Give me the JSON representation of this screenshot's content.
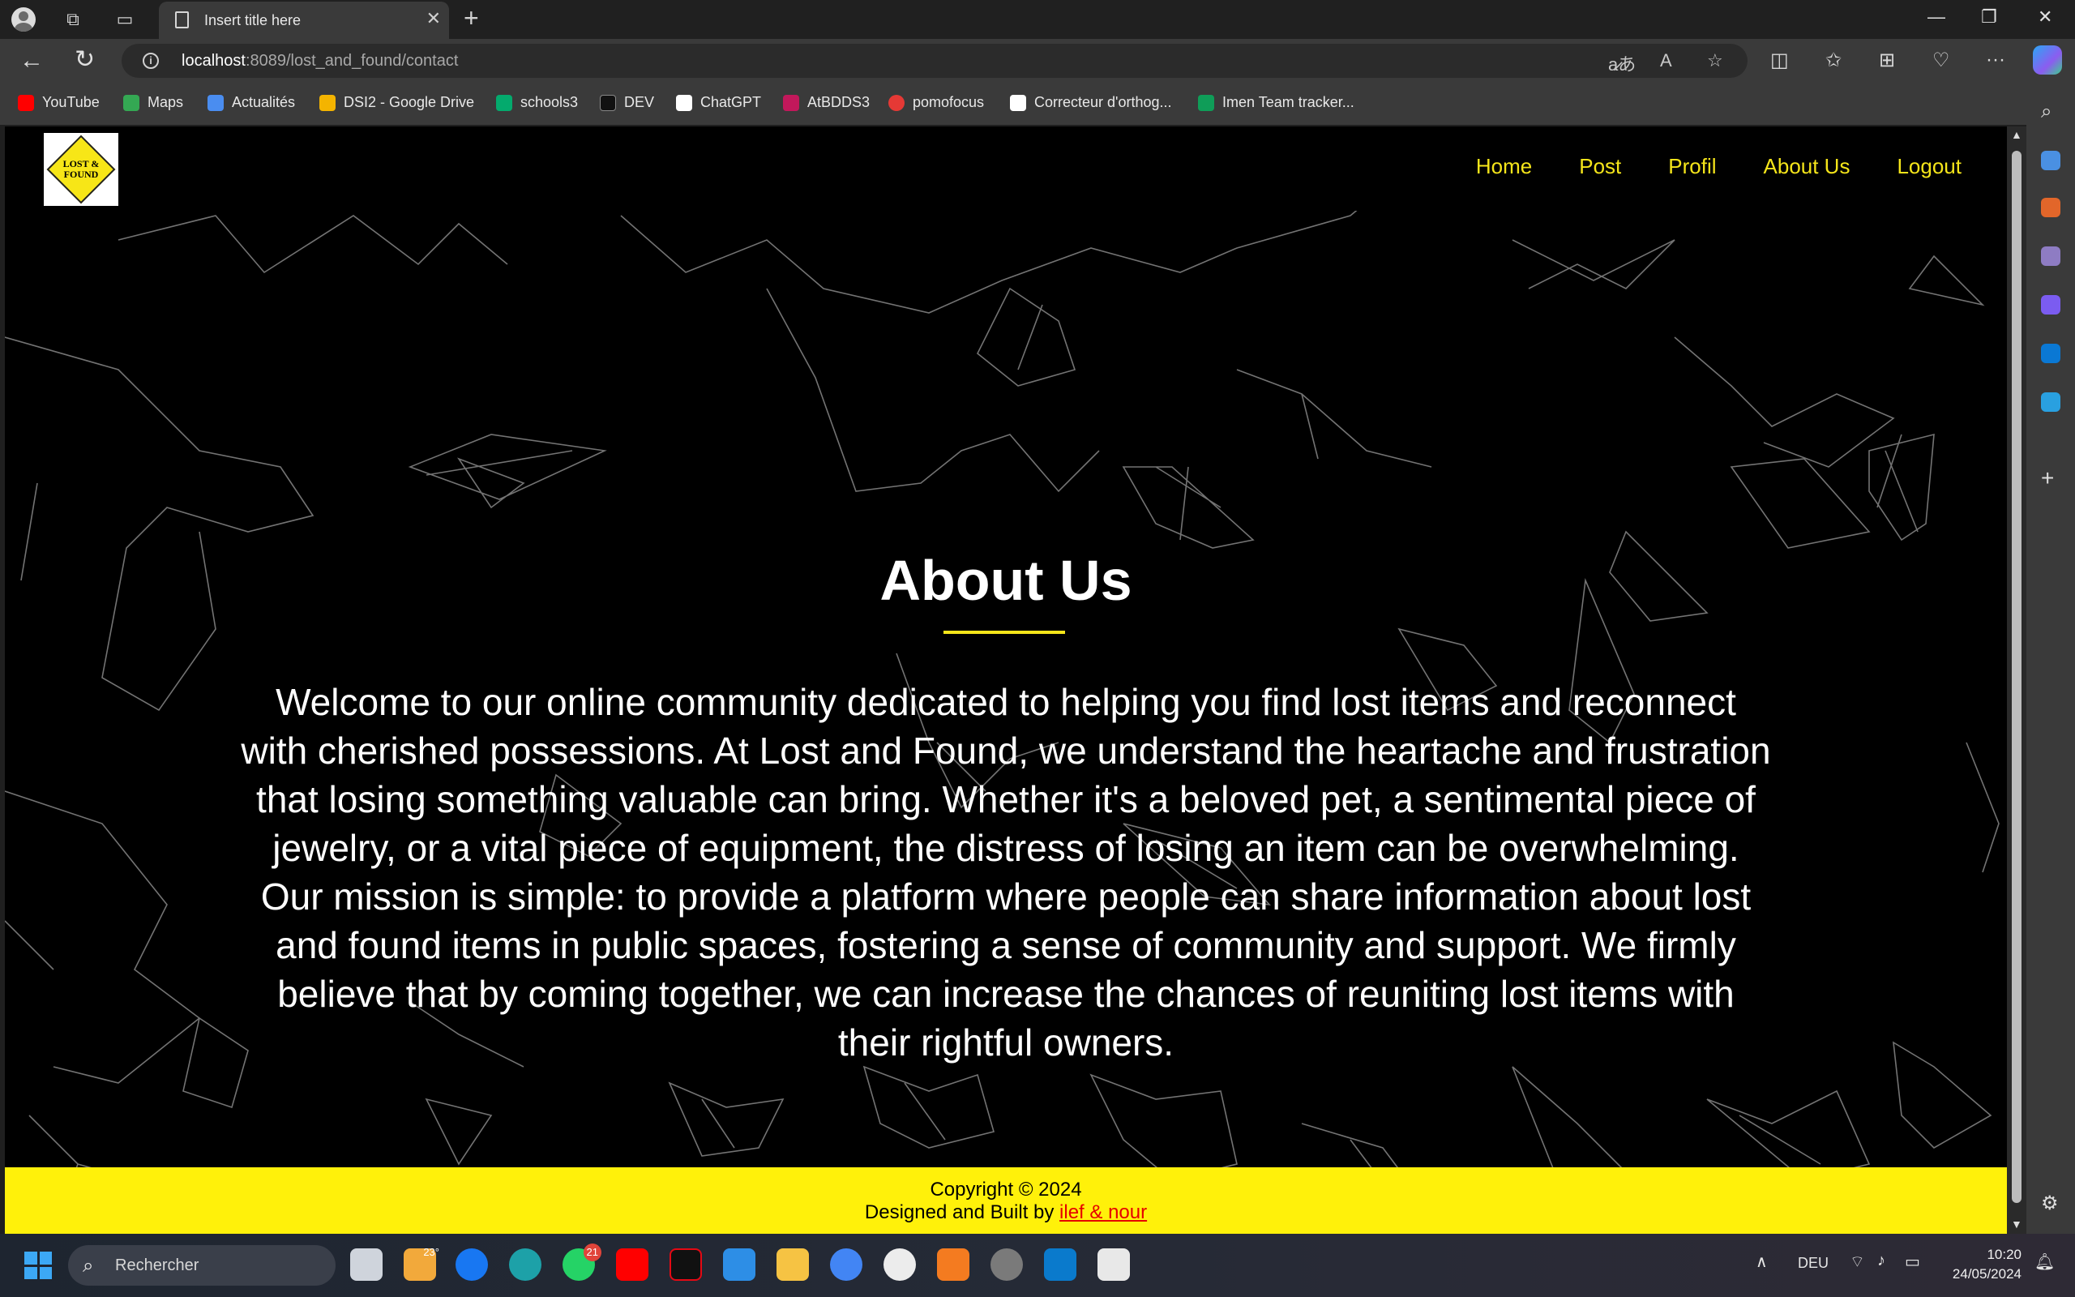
{
  "browser": {
    "tab_title": "Insert title here",
    "url_host": "localhost",
    "url_path": ":8089/lost_and_found/contact",
    "bookmarks": [
      {
        "label": "YouTube",
        "color": "#ff0000"
      },
      {
        "label": "Maps",
        "color": "#34a853"
      },
      {
        "label": "Actualités",
        "color": "#4a8df0"
      },
      {
        "label": "DSI2 - Google Drive",
        "color": "#f4b400"
      },
      {
        "label": "schools3",
        "color": "#04aa6d"
      },
      {
        "label": "DEV",
        "color": "#111111"
      },
      {
        "label": "ChatGPT",
        "color": "#ffffff"
      },
      {
        "label": "AtBDDS3",
        "color": "#c2185b"
      },
      {
        "label": "pomofocus",
        "color": "#e53935"
      },
      {
        "label": "Correcteur d'orthog...",
        "color": "#ffffff"
      },
      {
        "label": "Imen Team tracker...",
        "color": "#0f9d58"
      }
    ]
  },
  "site": {
    "logo_text": "LOST & FOUND",
    "nav": [
      "Home",
      "Post",
      "Profil",
      "About Us",
      "Logout"
    ],
    "title": "About Us",
    "paragraph": "Welcome to our online community dedicated to helping you find lost items and reconnect with cherished possessions. At Lost and Found, we understand the heartache and frustration that losing something valuable can bring. Whether it's a beloved pet, a sentimental piece of jewelry, or a vital piece of equipment, the distress of losing an item can be overwhelming. Our mission is simple: to provide a platform where people can share information about lost and found items in public spaces, fostering a sense of community and support. We firmly believe that by coming together, we can increase the chances of reuniting lost items with their rightful owners.",
    "footer_copyright": "Copyright © 2024",
    "footer_designed": "Designed and Built by",
    "footer_authors": "ilef & nour",
    "accent_color": "#f5e51a",
    "footer_color": "#fff10a"
  },
  "taskbar": {
    "search_placeholder": "Rechercher",
    "weather_temp": "23°",
    "whatsapp_badge": "21",
    "language": "DEU",
    "time": "10:20",
    "date": "24/05/2024"
  }
}
